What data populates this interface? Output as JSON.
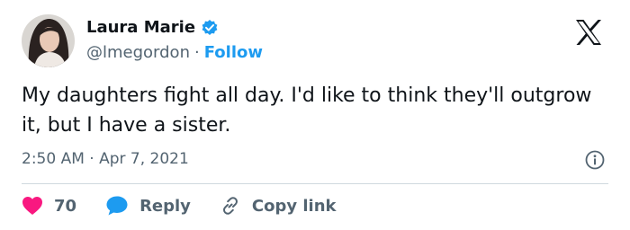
{
  "author": {
    "name": "Laura Marie",
    "handle": "@lmegordon",
    "separator": "·",
    "follow_label": "Follow"
  },
  "tweet": {
    "text": "My daughters fight all day. I'd like to think they'll outgrow it, but I have a sister.",
    "timestamp": "2:50 AM · Apr 7, 2021"
  },
  "actions": {
    "like_count": "70",
    "reply_label": "Reply",
    "copy_label": "Copy link"
  },
  "icons": {
    "verified": "verified-badge-icon",
    "x_logo": "x-logo-icon",
    "info": "info-icon",
    "like": "heart-icon",
    "reply": "speech-bubble-icon",
    "copy": "link-icon"
  },
  "colors": {
    "accent": "#1d9bf0",
    "like": "#f91880",
    "text": "#0f1419",
    "muted": "#536471",
    "divider": "#cfd9de"
  }
}
